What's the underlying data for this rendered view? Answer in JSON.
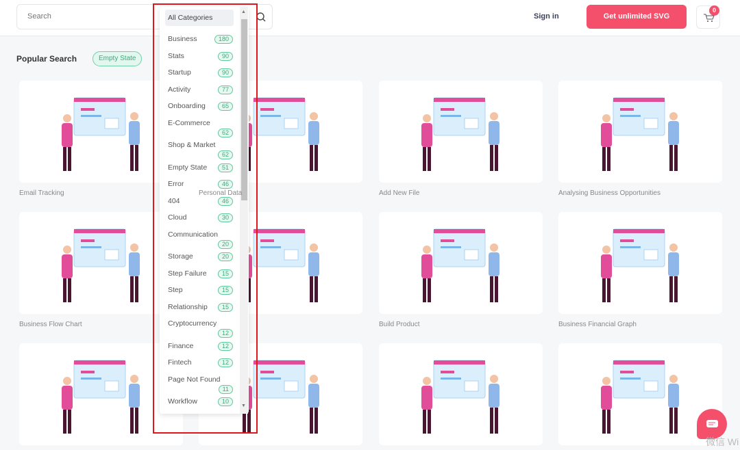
{
  "header": {
    "search_placeholder": "Search",
    "sign_in": "Sign in",
    "cta": "Get unlimited SVG",
    "cart_count": "0"
  },
  "popular": {
    "title": "Popular Search",
    "tags": [
      "Empty State"
    ]
  },
  "cards": [
    {
      "label": "Email Tracking"
    },
    {
      "label": "Personal Data"
    },
    {
      "label": "Add New File"
    },
    {
      "label": "Analysing Business Opportunities"
    },
    {
      "label": "Business Flow Chart"
    },
    {
      "label": ""
    },
    {
      "label": "Build Product"
    },
    {
      "label": "Business Financial Graph"
    },
    {
      "label": ""
    },
    {
      "label": ""
    },
    {
      "label": ""
    },
    {
      "label": ""
    }
  ],
  "dropdown": {
    "selected": "All Categories",
    "items": [
      {
        "label": "Business",
        "count": "180"
      },
      {
        "label": "Stats",
        "count": "90"
      },
      {
        "label": "Startup",
        "count": "90"
      },
      {
        "label": "Activity",
        "count": "77"
      },
      {
        "label": "Onboarding",
        "count": "65"
      },
      {
        "label": "E-Commerce",
        "count": "62"
      },
      {
        "label": "Shop & Market",
        "count": "62"
      },
      {
        "label": "Empty State",
        "count": "51"
      },
      {
        "label": "Error",
        "count": "46"
      },
      {
        "label": "404",
        "count": "46"
      },
      {
        "label": "Cloud",
        "count": "30"
      },
      {
        "label": "Communication",
        "count": "20"
      },
      {
        "label": "Storage",
        "count": "20"
      },
      {
        "label": "Step Failure",
        "count": "15"
      },
      {
        "label": "Step",
        "count": "15"
      },
      {
        "label": "Relationship",
        "count": "15"
      },
      {
        "label": "Cryptocurrency",
        "count": "12"
      },
      {
        "label": "Finance",
        "count": "12"
      },
      {
        "label": "Fintech",
        "count": "12"
      },
      {
        "label": "Page Not Found",
        "count": "11"
      },
      {
        "label": "Workflow",
        "count": "10"
      }
    ]
  },
  "colors": {
    "accent": "#f5506b",
    "tag_green": "#3cab7c",
    "highlight": "#e0161b"
  },
  "watermark": "微信 Wi"
}
